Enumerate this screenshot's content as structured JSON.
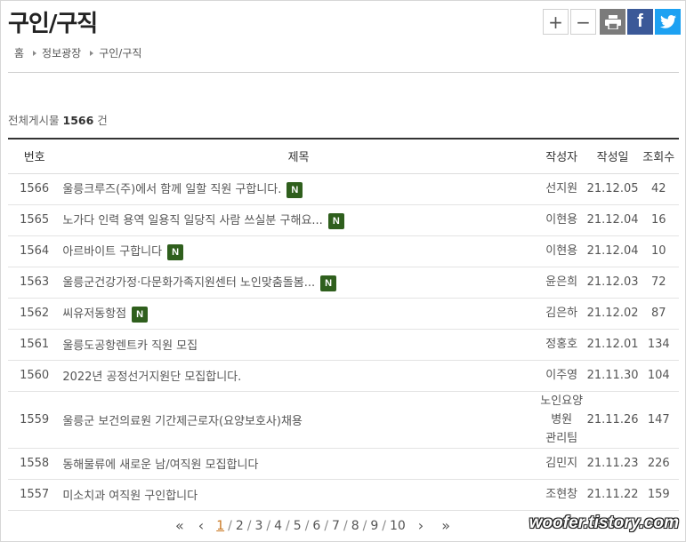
{
  "page": {
    "title": "구인/구직"
  },
  "tools": {
    "zoom_in": "+",
    "zoom_out": "−",
    "facebook": "f"
  },
  "breadcrumb": [
    "홈",
    "정보광장",
    "구인/구직"
  ],
  "summary": {
    "label": "전체게시물",
    "count": "1566",
    "unit": "건"
  },
  "table": {
    "headers": {
      "num": "번호",
      "title": "제목",
      "writer": "작성자",
      "date": "작성일",
      "views": "조회수"
    },
    "rows": [
      {
        "num": "1566",
        "title": "울릉크루즈(주)에서 함께 일할 직원 구합니다.",
        "new": "N",
        "writer": "선지원",
        "date": "21.12.05",
        "views": "42"
      },
      {
        "num": "1565",
        "title": "노가다 인력 용역 일용직 일당직 사람 쓰실분 구해요...",
        "new": "N",
        "writer": "이현용",
        "date": "21.12.04",
        "views": "16"
      },
      {
        "num": "1564",
        "title": "아르바이트 구합니다",
        "new": "N",
        "writer": "이현용",
        "date": "21.12.04",
        "views": "10"
      },
      {
        "num": "1563",
        "title": "울릉군건강가정·다문화가족지원센터 노인맞춤돌봄...",
        "new": "N",
        "writer": "윤은희",
        "date": "21.12.03",
        "views": "72"
      },
      {
        "num": "1562",
        "title": "씨유저동항점",
        "new": "N",
        "writer": "김은하",
        "date": "21.12.02",
        "views": "87"
      },
      {
        "num": "1561",
        "title": "울릉도공항렌트카 직원 모집",
        "new": "",
        "writer": "정홍호",
        "date": "21.12.01",
        "views": "134"
      },
      {
        "num": "1560",
        "title": "2022년 공정선거지원단 모집합니다.",
        "new": "",
        "writer": "이주영",
        "date": "21.11.30",
        "views": "104"
      },
      {
        "num": "1559",
        "title": "울릉군 보건의료원 기간제근로자(요양보호사)채용",
        "new": "",
        "writer": "노인요양병원",
        "writer2": "관리팀",
        "date": "21.11.26",
        "views": "147"
      },
      {
        "num": "1558",
        "title": "동해물류에 새로운 남/여직원 모집합니다",
        "new": "",
        "writer": "김민지",
        "date": "21.11.23",
        "views": "226"
      },
      {
        "num": "1557",
        "title": "미소치과 여직원 구인합니다",
        "new": "",
        "writer": "조현창",
        "date": "21.11.22",
        "views": "159"
      }
    ]
  },
  "pagination": {
    "first": "«",
    "prev": "‹",
    "next": "›",
    "last": "»",
    "pages": [
      "1",
      "2",
      "3",
      "4",
      "5",
      "6",
      "7",
      "8",
      "9",
      "10"
    ],
    "current": "1"
  },
  "watermark": "woofer.tistory.com"
}
